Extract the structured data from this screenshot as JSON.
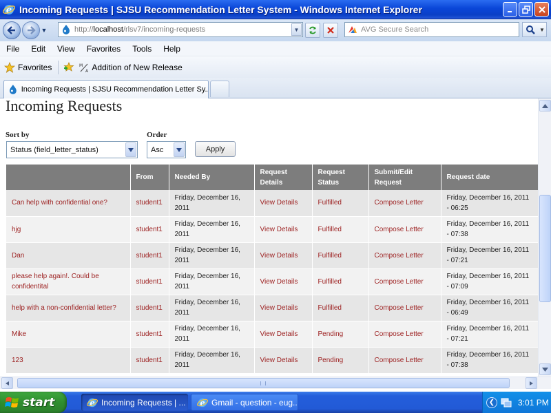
{
  "window": {
    "title": "Incoming Requests | SJSU Recommendation Letter System - Windows Internet Explorer"
  },
  "address_bar": {
    "url_prefix": "http://",
    "url_host": "localhost",
    "url_path": "/rlsv7/incoming-requests",
    "search_placeholder": "AVG Secure Search"
  },
  "menu": [
    "File",
    "Edit",
    "View",
    "Favorites",
    "Tools",
    "Help"
  ],
  "favorites_bar": {
    "favorites_label": "Favorites",
    "link_label": "Addition of New Release"
  },
  "tabs": [
    {
      "label": "Incoming Requests | SJSU Recommendation Letter Sy..."
    }
  ],
  "page": {
    "title": "Incoming Requests",
    "sort_by_label": "Sort by",
    "sort_by_value": "Status (field_letter_status)",
    "order_label": "Order",
    "order_value": "Asc",
    "apply_label": "Apply"
  },
  "table": {
    "headers": [
      "",
      "From",
      "Needed By",
      "Request Details",
      "Request Status",
      "Submit/Edit Request",
      "Request date"
    ],
    "rows": [
      {
        "title": "Can help with confidential one?",
        "from": "student1",
        "needed_by": "Friday, December 16, 2011",
        "details": "View Details",
        "status": "Fulfilled",
        "action": "Compose Letter",
        "date": "Friday, December 16, 2011 - 06:25"
      },
      {
        "title": "hjg",
        "from": "student1",
        "needed_by": "Friday, December 16, 2011",
        "details": "View Details",
        "status": "Fulfilled",
        "action": "Compose Letter",
        "date": "Friday, December 16, 2011 - 07:38"
      },
      {
        "title": "Dan",
        "from": "student1",
        "needed_by": "Friday, December 16, 2011",
        "details": "View Details",
        "status": "Fulfilled",
        "action": "Compose Letter",
        "date": "Friday, December 16, 2011 - 07:21"
      },
      {
        "title": "please help again!. Could be confidentital",
        "from": "student1",
        "needed_by": "Friday, December 16, 2011",
        "details": "View Details",
        "status": "Fulfilled",
        "action": "Compose Letter",
        "date": "Friday, December 16, 2011 - 07:09"
      },
      {
        "title": "help with a non-confidential letter?",
        "from": "student1",
        "needed_by": "Friday, December 16, 2011",
        "details": "View Details",
        "status": "Fulfilled",
        "action": "Compose Letter",
        "date": "Friday, December 16, 2011 - 06:49"
      },
      {
        "title": "Mike",
        "from": "student1",
        "needed_by": "Friday, December 16, 2011",
        "details": "View Details",
        "status": "Pending",
        "action": "Compose Letter",
        "date": "Friday, December 16, 2011 - 07:21"
      },
      {
        "title": "123",
        "from": "student1",
        "needed_by": "Friday, December 16, 2011",
        "details": "View Details",
        "status": "Pending",
        "action": "Compose Letter",
        "date": "Friday, December 16, 2011 - 07:38"
      }
    ]
  },
  "taskbar": {
    "start_label": "start",
    "tasks": [
      {
        "label": "Incoming Requests | ...",
        "active": true
      },
      {
        "label": "Gmail - question - eug...",
        "active": false
      }
    ],
    "clock": "3:01 PM"
  },
  "colors": {
    "link": "#9c1f1f",
    "table_header_bg": "#7d7d7d",
    "row_odd": "#e6e6e6",
    "row_even": "#f2f2f2",
    "titlebar": "#0a46d8"
  }
}
